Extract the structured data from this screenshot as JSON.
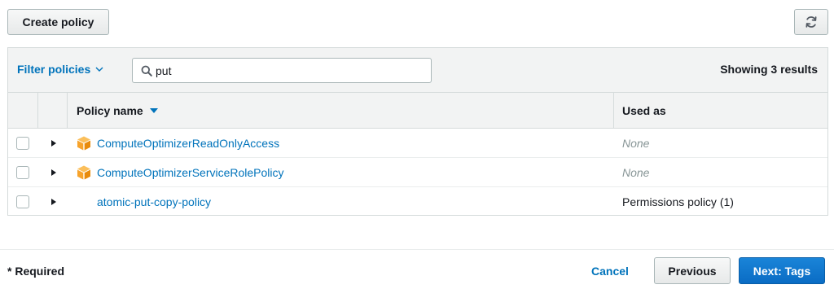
{
  "toolbar": {
    "create_label": "Create policy",
    "refresh_icon": "refresh-icon"
  },
  "filter": {
    "dropdown_label": "Filter policies",
    "search_value": "put",
    "results_text": "Showing 3 results"
  },
  "table": {
    "columns": {
      "name": "Policy name",
      "used_as": "Used as"
    },
    "rows": [
      {
        "name": "ComputeOptimizerReadOnlyAccess",
        "used_as": "None",
        "aws_managed": true
      },
      {
        "name": "ComputeOptimizerServiceRolePolicy",
        "used_as": "None",
        "aws_managed": true
      },
      {
        "name": "atomic-put-copy-policy",
        "used_as": "Permissions policy (1)",
        "aws_managed": false
      }
    ]
  },
  "footer": {
    "required_label": "* Required",
    "cancel_label": "Cancel",
    "previous_label": "Previous",
    "next_label": "Next: Tags"
  },
  "colors": {
    "link": "#0073bb",
    "primary": "#0a6cc4",
    "aws_icon": "#f7a32b"
  }
}
